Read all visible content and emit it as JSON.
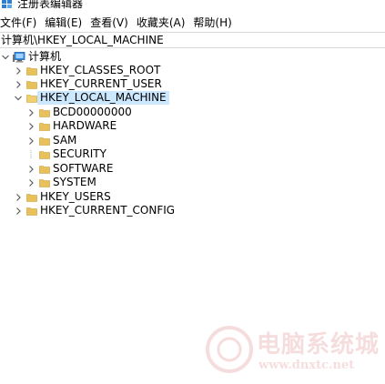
{
  "window": {
    "title": "注册表编辑器"
  },
  "menu": {
    "items": [
      "文件(F)",
      "编辑(E)",
      "查看(V)",
      "收藏夹(A)",
      "帮助(H)"
    ]
  },
  "address": {
    "path": "计算机\\HKEY_LOCAL_MACHINE"
  },
  "tree": {
    "root": "计算机",
    "hives": {
      "classes_root": "HKEY_CLASSES_ROOT",
      "current_user": "HKEY_CURRENT_USER",
      "local_machine": "HKEY_LOCAL_MACHINE",
      "users": "HKEY_USERS",
      "current_config": "HKEY_CURRENT_CONFIG"
    },
    "local_machine_children": {
      "bcd": "BCD00000000",
      "hardware": "HARDWARE",
      "sam": "SAM",
      "security": "SECURITY",
      "software": "SOFTWARE",
      "system": "SYSTEM"
    },
    "selected": "HKEY_LOCAL_MACHINE"
  },
  "watermark": {
    "cn": "电脑系统城",
    "url": "www.dnxtc.net"
  },
  "colors": {
    "selection": "#cce8ff",
    "folder": "#e8c15b",
    "chevron": "#5c5c5c"
  },
  "icons": {
    "app": "registry-icon",
    "computer": "computer-icon",
    "folder": "folder-icon",
    "expand": "chevron-right-icon",
    "collapse": "chevron-down-icon"
  }
}
